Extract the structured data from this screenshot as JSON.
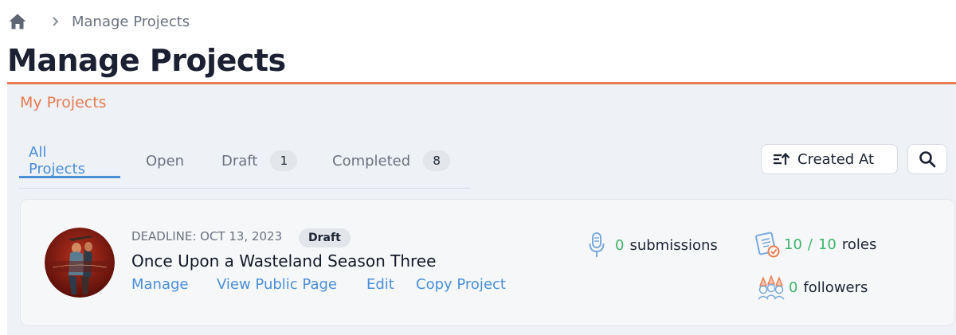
{
  "breadcrumb": {
    "home_icon": "home-icon",
    "separator_icon": "chevron-right-icon",
    "current": "Manage Projects"
  },
  "page_title": "Manage Projects",
  "section_title": "My Projects",
  "tabs": [
    {
      "label": "All Projects",
      "active": true
    },
    {
      "label": "Open"
    },
    {
      "label": "Draft",
      "count": "1"
    },
    {
      "label": "Completed",
      "count": "8"
    }
  ],
  "toolbar": {
    "sort_label": "Created At",
    "sort_icon": "sort-ascending-icon",
    "search_icon": "search-icon"
  },
  "project": {
    "deadline": "DEADLINE: OCT 13, 2023",
    "status": "Draft",
    "name": "Once Upon a Wasteland Season Three",
    "avatar_icon": "project-avatar",
    "actions": [
      "Manage",
      "View Public Page",
      "Edit",
      "Copy Project"
    ],
    "stats": {
      "submissions_count": "0",
      "submissions_label": "submissions",
      "roles_filled": "10",
      "roles_total": "10",
      "roles_label": "roles",
      "followers_count": "0",
      "followers_label": "followers"
    }
  },
  "colors": {
    "accent": "#e77b4f",
    "link": "#4a8fd8",
    "green": "#3fb36b",
    "panel": "#eef1f6"
  }
}
